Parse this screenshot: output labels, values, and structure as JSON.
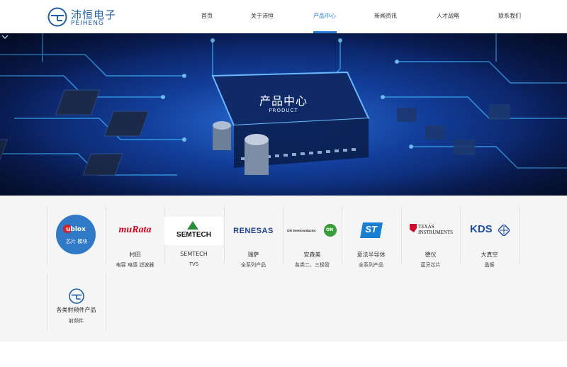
{
  "brand": {
    "name_cn": "沛恒电子",
    "name_en": "PEIHENG",
    "color": "#1f5fa6"
  },
  "nav": {
    "items": [
      "首页",
      "关于沛恒",
      "产品中心",
      "新闻资讯",
      "人才战略",
      "联系我们"
    ],
    "active_index": 2,
    "active_color": "#2a7bd0"
  },
  "banner": {
    "title": "产品中心",
    "subtitle": "PRODUCT",
    "chevron_icon": "chevron-down-icon"
  },
  "products": [
    {
      "logo_text": "ublox",
      "logo_caption": "芯片 模块",
      "name": "",
      "desc": ""
    },
    {
      "logo_text": "muRata",
      "name": "村田",
      "desc": "电容 电感 滤波器"
    },
    {
      "logo_text": "SEMTECH",
      "name": "SEMTECH",
      "desc": "TVS"
    },
    {
      "logo_text": "RENESAS",
      "name": "瑞萨",
      "desc": "全系列产品"
    },
    {
      "logo_text": "ON Semiconductor",
      "logo_badge": "ON",
      "name": "安森美",
      "desc": "各类二、三极管"
    },
    {
      "logo_text": "ST",
      "name": "意法半导体",
      "desc": "全系列产品"
    },
    {
      "logo_text": "TEXAS INSTRUMENTS",
      "name": "德仪",
      "desc": "蓝牙芯片"
    },
    {
      "logo_text": "KDS",
      "name": "大真空",
      "desc": "晶振"
    },
    {
      "logo_text": "",
      "name": "各类射频件产品",
      "desc": "射频件"
    }
  ],
  "colors": {
    "murata_red": "#d6001c",
    "semtech_green": "#2d8a3a",
    "renesas_blue": "#1d3e8f",
    "st_blue": "#1a7fd1",
    "ti_red": "#c8102e",
    "kds_blue": "#1f4e9e",
    "onsemi_green": "#3a9d3a"
  }
}
